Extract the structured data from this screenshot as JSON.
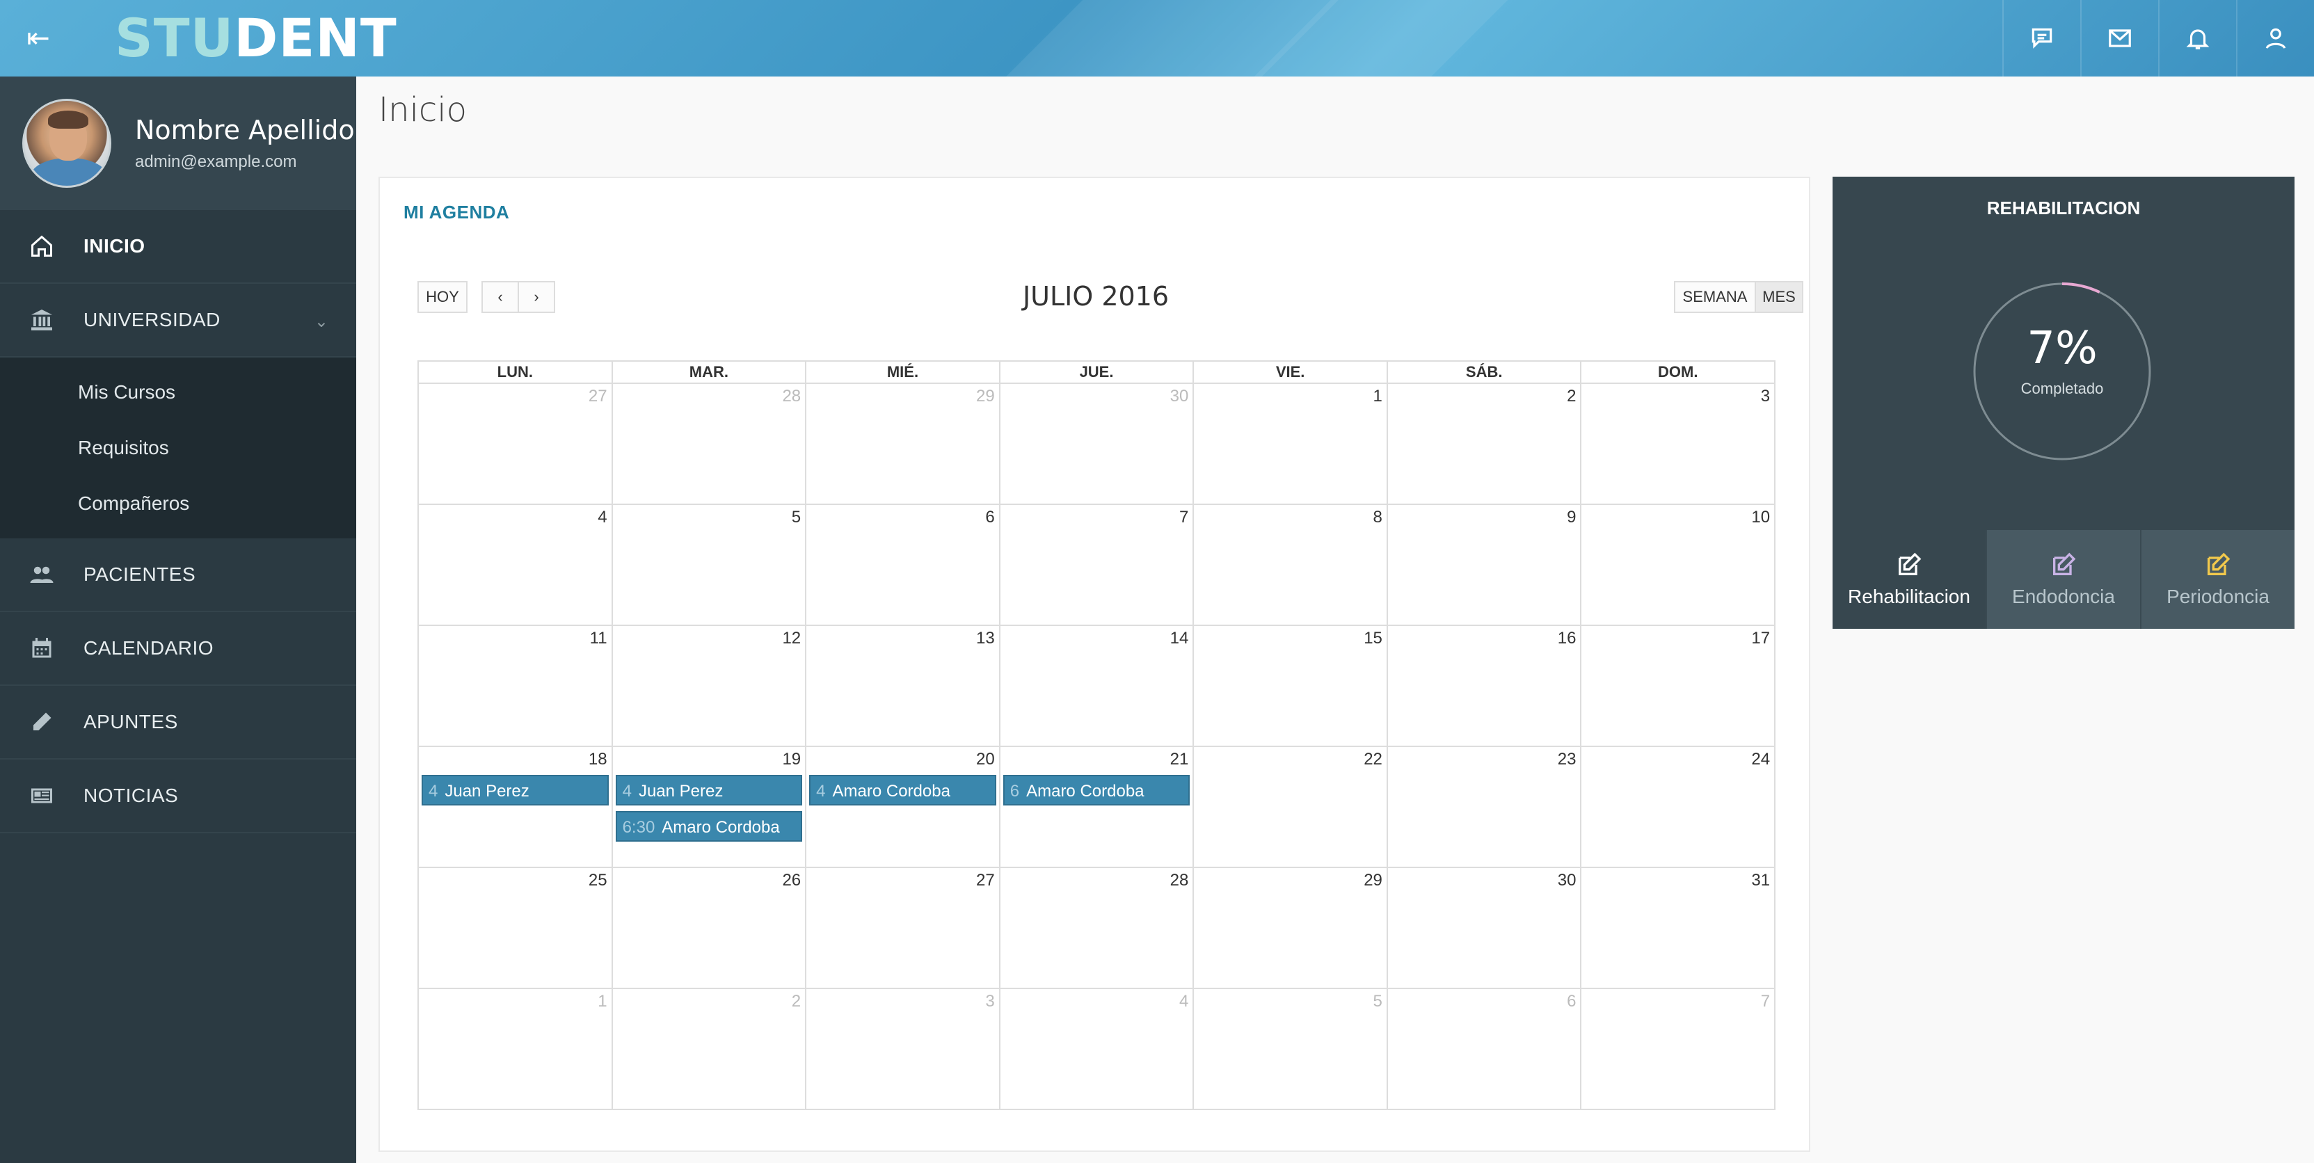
{
  "header": {
    "logo_part1": "STU",
    "logo_part2": "DENT",
    "icons": [
      "chat-icon",
      "mail-icon",
      "bell-icon",
      "user-icon"
    ]
  },
  "profile": {
    "name": "Nombre Apellido",
    "email": "admin@example.com"
  },
  "sidebar": {
    "items": [
      {
        "label": "INICIO",
        "icon": "home-icon"
      },
      {
        "label": "UNIVERSIDAD",
        "icon": "university-icon"
      },
      {
        "label": "PACIENTES",
        "icon": "users-icon"
      },
      {
        "label": "CALENDARIO",
        "icon": "calendar-icon"
      },
      {
        "label": "APUNTES",
        "icon": "pencil-icon"
      },
      {
        "label": "NOTICIAS",
        "icon": "newspaper-icon"
      }
    ],
    "submenu": [
      "Mis Cursos",
      "Requisitos",
      "Compañeros"
    ]
  },
  "page": {
    "title": "Inicio"
  },
  "agenda": {
    "title": "MI AGENDA",
    "today_label": "HOY",
    "month_title": "JULIO 2016",
    "view_week": "SEMANA",
    "view_month": "MES",
    "weekdays": [
      "LUN.",
      "MAR.",
      "MIÉ.",
      "JUE.",
      "VIE.",
      "SÁB.",
      "DOM."
    ],
    "weeks": [
      [
        "27",
        "28",
        "29",
        "30",
        "1",
        "2",
        "3"
      ],
      [
        "4",
        "5",
        "6",
        "7",
        "8",
        "9",
        "10"
      ],
      [
        "11",
        "12",
        "13",
        "14",
        "15",
        "16",
        "17"
      ],
      [
        "18",
        "19",
        "20",
        "21",
        "22",
        "23",
        "24"
      ],
      [
        "25",
        "26",
        "27",
        "28",
        "29",
        "30",
        "31"
      ],
      [
        "1",
        "2",
        "3",
        "4",
        "5",
        "6",
        "7"
      ]
    ],
    "events": [
      {
        "time": "4",
        "title": "Juan Perez"
      },
      {
        "time": "4",
        "title": "Juan Perez"
      },
      {
        "time": "6:30",
        "title": "Amaro Cordoba"
      },
      {
        "time": "4",
        "title": "Amaro Cordoba"
      },
      {
        "time": "6",
        "title": "Amaro Cordoba"
      }
    ]
  },
  "rehab": {
    "title": "REHABILITACION",
    "percent": "7%",
    "progress": 0.07,
    "completed_label": "Completado",
    "tabs": [
      {
        "label": "Rehabilitacion",
        "icon_color": "#ffffff"
      },
      {
        "label": "Endodoncia",
        "icon_color": "#c9b3e6"
      },
      {
        "label": "Periodoncia",
        "icon_color": "#f2c94c"
      }
    ]
  },
  "colors": {
    "event": "#3a87ad",
    "accent": "#1f7fa0",
    "sidebar": "#2b3a42"
  }
}
